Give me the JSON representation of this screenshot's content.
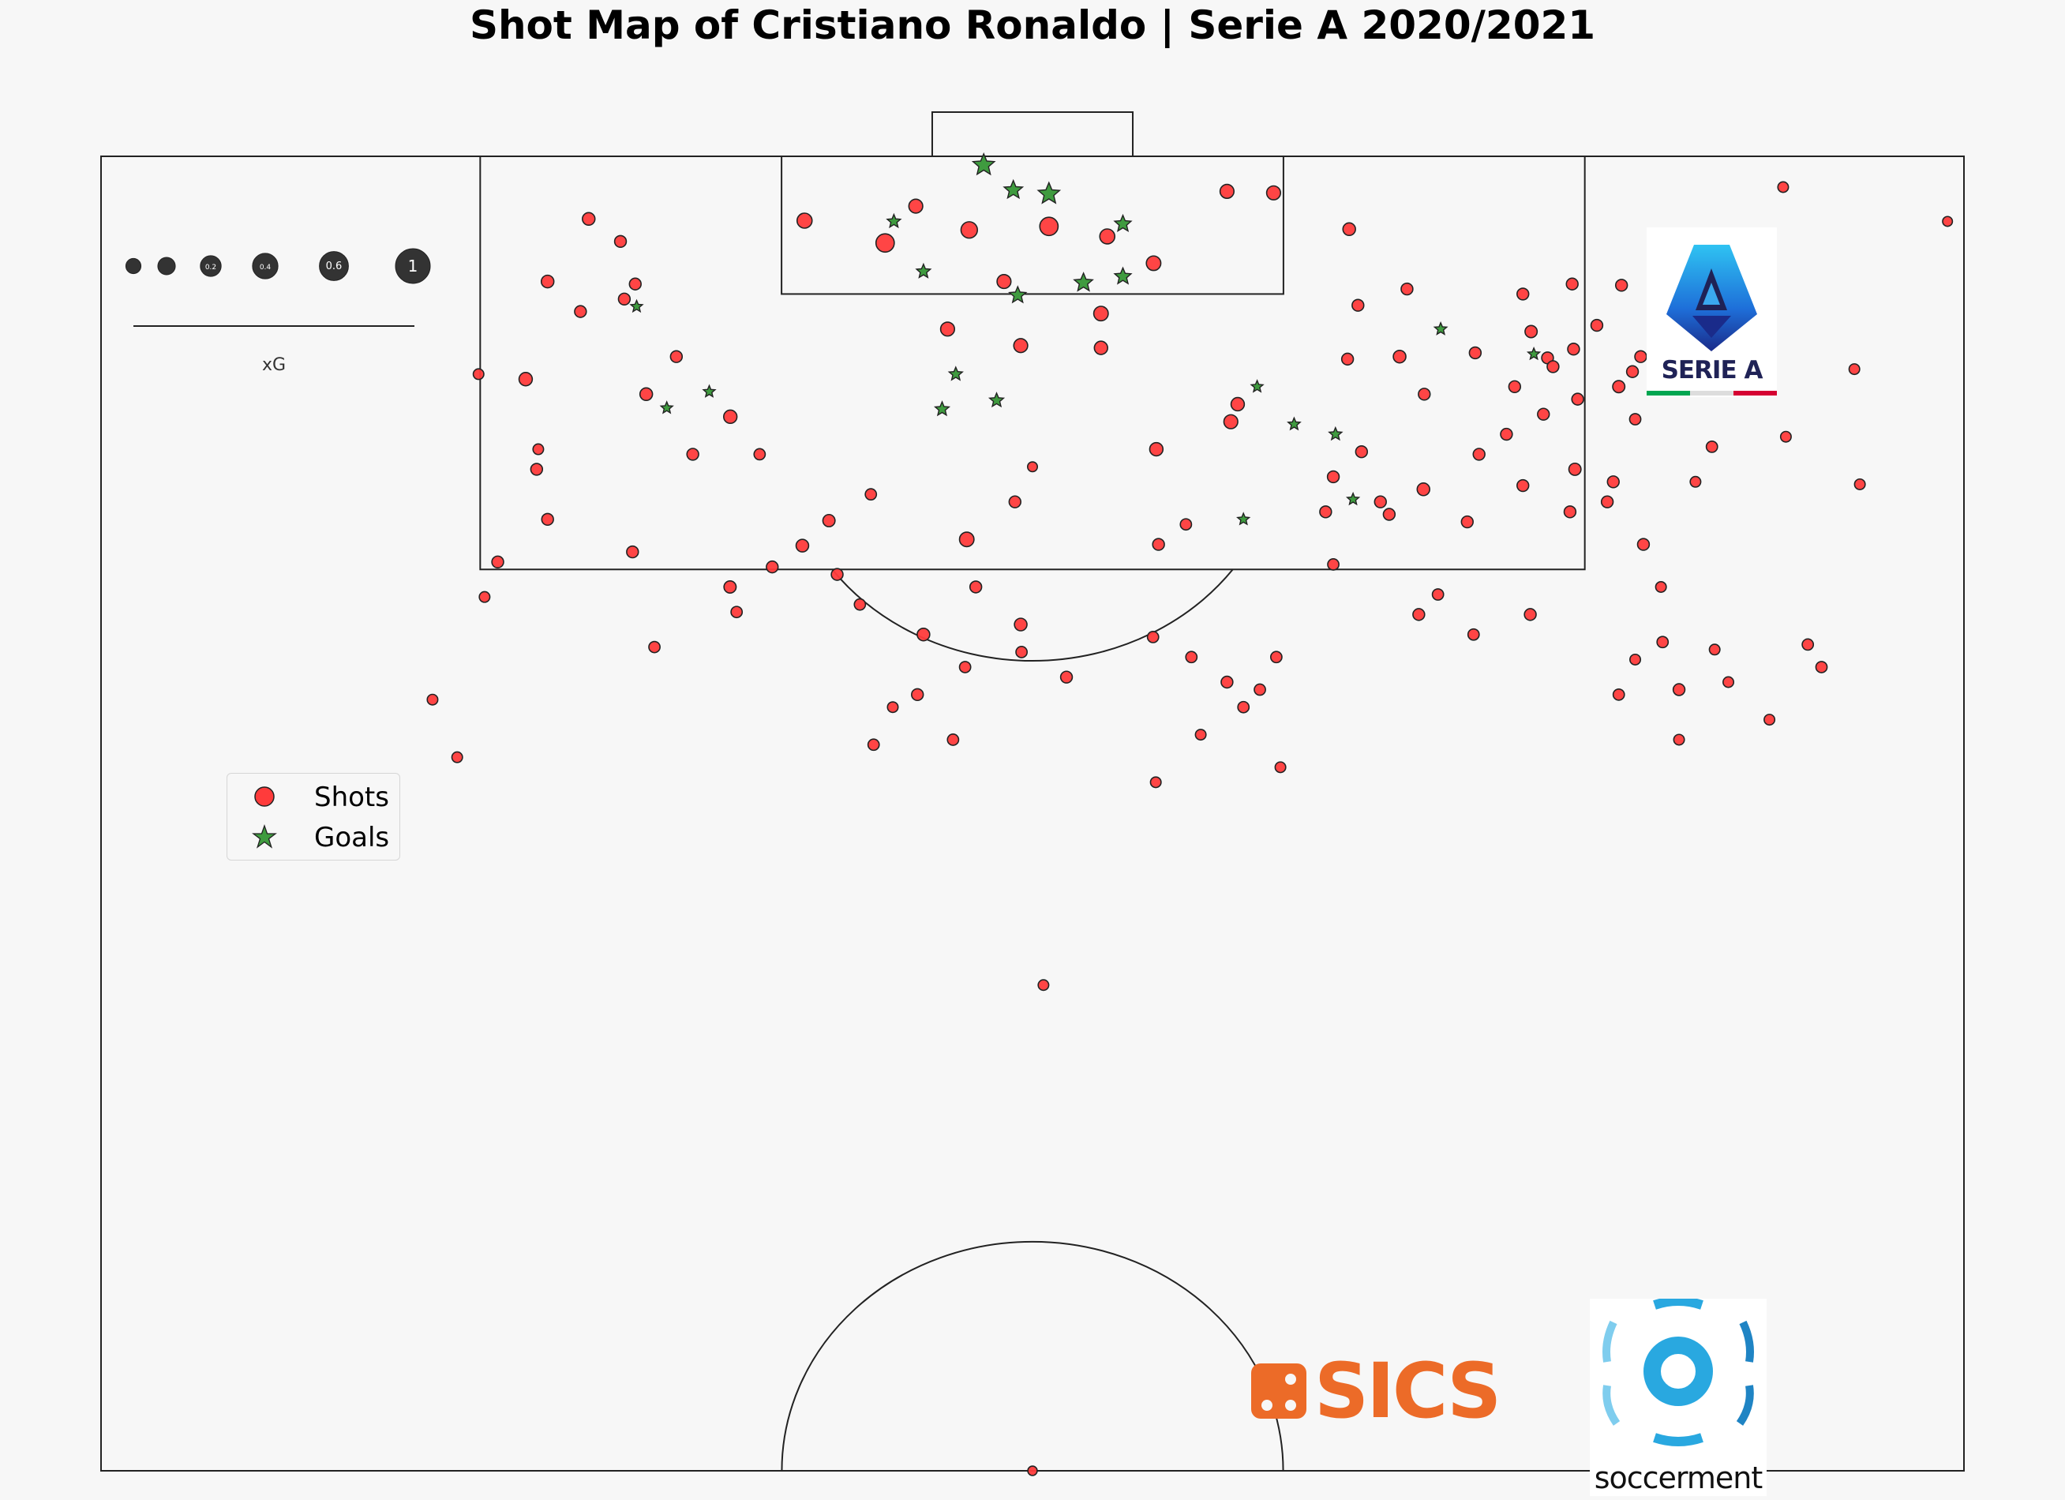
{
  "chart_data": {
    "type": "scatter",
    "title": "Shot Map of Cristiano Ronaldo | Serie A 2020/2021",
    "coordinate_system": "half-pitch, x = metres from left touchline (0-68), y = metres from goal line (0-52.5)",
    "pitch": {
      "width_m": 68,
      "half_length_m": 52.5,
      "penalty_box_width_m": 40.32,
      "penalty_box_depth_m": 16.5,
      "six_yard_width_m": 18.32,
      "six_yard_depth_m": 5.5,
      "goal_width_m": 7.32,
      "penalty_spot_m": 11,
      "arc_radius_m": 9.15
    },
    "xg_legend": {
      "label": "xG",
      "values": [
        0.05,
        0.1,
        0.2,
        0.4,
        0.6,
        1.0
      ],
      "labels": [
        "",
        "",
        "0.2",
        "0.4",
        "0.6",
        "1"
      ]
    },
    "legend": [
      {
        "name": "Shots",
        "color": "#ff3b3b"
      },
      {
        "name": "Goals",
        "color": "#3f9b3f"
      }
    ],
    "shots": [
      [
        25.68,
        2.57,
        0.07
      ],
      [
        28.62,
        3.46,
        0.15
      ],
      [
        29.74,
        1.99,
        0.05
      ],
      [
        31.69,
        2.94,
        0.1
      ],
      [
        34.6,
        2.8,
        0.15
      ],
      [
        30.9,
        6.9,
        0.05
      ],
      [
        32.96,
        5.0,
        0.05
      ],
      [
        36.73,
        3.2,
        0.07
      ],
      [
        33.57,
        7.56,
        0.05
      ],
      [
        36.5,
        6.28,
        0.06
      ],
      [
        38.42,
        4.27,
        0.06
      ],
      [
        41.1,
        1.4,
        0.05
      ],
      [
        42.8,
        1.46,
        0.05
      ],
      [
        45.56,
        2.91,
        0.03
      ],
      [
        22.97,
        10.4,
        0.04
      ],
      [
        38.52,
        11.7,
        0.04
      ],
      [
        41.24,
        10.6,
        0.05
      ],
      [
        41.49,
        9.9,
        0.04
      ],
      [
        21.0,
        8.0,
        0.02
      ],
      [
        26.57,
        14.55,
        0.025
      ],
      [
        28.1,
        13.5,
        0.015
      ],
      [
        38.6,
        15.5,
        0.02
      ],
      [
        33.36,
        13.8,
        0.02
      ],
      [
        31.6,
        15.3,
        0.06
      ],
      [
        31.93,
        17.2,
        0.02
      ],
      [
        26.87,
        16.7,
        0.02
      ],
      [
        22.96,
        17.2,
        0.025
      ],
      [
        46.01,
        11.8,
        0.02
      ],
      [
        33.57,
        18.7,
        0.03
      ],
      [
        36.5,
        7.65,
        0.04
      ],
      [
        45.88,
        5.95,
        0.02
      ],
      [
        47.67,
        5.3,
        0.02
      ],
      [
        45.5,
        8.1,
        0.02
      ],
      [
        47.4,
        8.0,
        0.03
      ],
      [
        48.27,
        13.3,
        0.03
      ],
      [
        50.16,
        7.85,
        0.02
      ],
      [
        50.3,
        11.9,
        0.02
      ],
      [
        49.87,
        14.6,
        0.02
      ],
      [
        53.8,
        12.5,
        0.025
      ],
      [
        54.98,
        13.8,
        0.02
      ],
      [
        48.3,
        9.5,
        0.02
      ],
      [
        51.9,
        5.5,
        0.02
      ],
      [
        53.7,
        5.1,
        0.02
      ],
      [
        52.2,
        7.0,
        0.025
      ],
      [
        52.8,
        8.05,
        0.02
      ],
      [
        51.6,
        9.2,
        0.02
      ],
      [
        53.9,
        9.7,
        0.02
      ],
      [
        52.65,
        10.3,
        0.02
      ],
      [
        51.3,
        11.1,
        0.02
      ],
      [
        55.4,
        9.2,
        0.025
      ],
      [
        55.9,
        8.6,
        0.02
      ],
      [
        56.0,
        10.5,
        0.015
      ],
      [
        54.6,
        6.75,
        0.02
      ],
      [
        53.75,
        7.7,
        0.02
      ],
      [
        53.0,
        8.4,
        0.02
      ],
      [
        51.9,
        13.15,
        0.02
      ],
      [
        53.62,
        14.2,
        0.02
      ],
      [
        55.5,
        5.15,
        0.02
      ],
      [
        56.2,
        8.0,
        0.02
      ],
      [
        55.2,
        13.0,
        0.02
      ],
      [
        56.94,
        17.2,
        0.01
      ],
      [
        56.3,
        15.5,
        0.02
      ],
      [
        58.8,
        11.6,
        0.015
      ],
      [
        58.2,
        13.0,
        0.01
      ],
      [
        61.5,
        11.2,
        0.01
      ],
      [
        61.4,
        1.23,
        0.01
      ],
      [
        15.5,
        8.9,
        0.04
      ],
      [
        16.3,
        5.0,
        0.03
      ],
      [
        17.8,
        2.5,
        0.03
      ],
      [
        19.5,
        5.1,
        0.02
      ],
      [
        19.9,
        9.5,
        0.03
      ],
      [
        19.1,
        5.7,
        0.02
      ],
      [
        17.5,
        6.2,
        0.02
      ],
      [
        18.96,
        3.4,
        0.02
      ],
      [
        15.9,
        12.5,
        0.02
      ],
      [
        14.0,
        17.6,
        0.01
      ],
      [
        16.3,
        14.5,
        0.02
      ],
      [
        14.48,
        16.2,
        0.02
      ],
      [
        21.6,
        11.9,
        0.02
      ],
      [
        19.4,
        15.8,
        0.02
      ],
      [
        24.5,
        16.4,
        0.02
      ],
      [
        24.04,
        11.9,
        0.015
      ],
      [
        13.78,
        8.7,
        0.01
      ],
      [
        15.96,
        11.7,
        0.01
      ],
      [
        12.1,
        21.7,
        0.01
      ],
      [
        13.0,
        24.0,
        0.01
      ],
      [
        20.2,
        19.6,
        0.015
      ],
      [
        23.2,
        18.2,
        0.015
      ],
      [
        28.2,
        23.5,
        0.015
      ],
      [
        29.8,
        21.5,
        0.02
      ],
      [
        31.54,
        20.4,
        0.015
      ],
      [
        33.6,
        19.8,
        0.015
      ],
      [
        35.24,
        20.8,
        0.02
      ],
      [
        38.4,
        19.2,
        0.015
      ],
      [
        39.8,
        20.0,
        0.015
      ],
      [
        41.1,
        21.0,
        0.02
      ],
      [
        42.9,
        20.0,
        0.015
      ],
      [
        42.3,
        21.3,
        0.015
      ],
      [
        41.7,
        22.0,
        0.015
      ],
      [
        40.14,
        23.1,
        0.01
      ],
      [
        44.7,
        14.2,
        0.02
      ],
      [
        44.98,
        16.3,
        0.015
      ],
      [
        48.1,
        18.3,
        0.02
      ],
      [
        48.8,
        17.5,
        0.015
      ],
      [
        50.1,
        19.1,
        0.015
      ],
      [
        52.17,
        18.3,
        0.02
      ],
      [
        47.02,
        14.3,
        0.02
      ],
      [
        46.7,
        13.8,
        0.02
      ],
      [
        44.98,
        12.8,
        0.02
      ],
      [
        43.05,
        24.4,
        0.01
      ],
      [
        38.5,
        25.0,
        0.01
      ],
      [
        31.1,
        23.3,
        0.015
      ],
      [
        28.9,
        22.0,
        0.01
      ],
      [
        30.02,
        19.1,
        0.03
      ],
      [
        25.6,
        15.55,
        0.03
      ],
      [
        27.7,
        17.9,
        0.015
      ],
      [
        34.4,
        33.1,
        0.01
      ],
      [
        56.0,
        20.1,
        0.01
      ],
      [
        57.6,
        23.3,
        0.01
      ],
      [
        57.6,
        21.3,
        0.02
      ],
      [
        58.9,
        19.7,
        0.01
      ],
      [
        59.4,
        21.0,
        0.01
      ],
      [
        57.0,
        19.4,
        0.015
      ],
      [
        55.4,
        21.5,
        0.015
      ],
      [
        60.9,
        22.5,
        0.01
      ],
      [
        62.3,
        19.5,
        0.015
      ],
      [
        62.8,
        20.4,
        0.015
      ],
      [
        64.0,
        8.5,
        0.01
      ],
      [
        64.2,
        13.1,
        0.01
      ],
      [
        67.4,
        2.6,
        0.005
      ],
      [
        39.6,
        14.7,
        0.015
      ],
      [
        34.0,
        12.4,
        0.005
      ],
      [
        34.0,
        52.5,
        0.003
      ]
    ],
    "goals": [
      [
        28.94,
        2.6,
        0.04
      ],
      [
        30.02,
        4.6,
        0.05
      ],
      [
        32.22,
        0.35,
        0.25
      ],
      [
        33.3,
        1.35,
        0.15
      ],
      [
        34.6,
        1.5,
        0.25
      ],
      [
        35.86,
        5.05,
        0.15
      ],
      [
        33.46,
        5.55,
        0.1
      ],
      [
        37.3,
        2.7,
        0.1
      ],
      [
        37.3,
        4.8,
        0.1
      ],
      [
        31.2,
        8.7,
        0.04
      ],
      [
        30.7,
        10.1,
        0.05
      ],
      [
        32.69,
        9.75,
        0.05
      ],
      [
        20.65,
        10.05,
        0.02
      ],
      [
        19.55,
        6.0,
        0.02
      ],
      [
        43.55,
        10.7,
        0.025
      ],
      [
        42.2,
        9.2,
        0.02
      ],
      [
        48.9,
        6.9,
        0.025
      ],
      [
        45.06,
        11.1,
        0.03
      ],
      [
        45.7,
        13.7,
        0.02
      ],
      [
        22.2,
        9.4,
        0.02
      ],
      [
        41.7,
        14.5,
        0.02
      ],
      [
        52.3,
        7.9,
        0.02
      ]
    ]
  },
  "logos": {
    "serie_a": "SERIE A",
    "sics": "SICS",
    "soccerment": "soccerment"
  },
  "colors": {
    "shot": "#ff3b3b",
    "goal": "#3f9b3f",
    "legend_dot": "#333333",
    "sics_orange": "#ec6b28",
    "soccerment_blue": "#29a8e0",
    "serie_a_navy": "#1f2256",
    "serie_a_blue": "#1e9ee8",
    "italy_green": "#00a651",
    "italy_red": "#d50032"
  }
}
